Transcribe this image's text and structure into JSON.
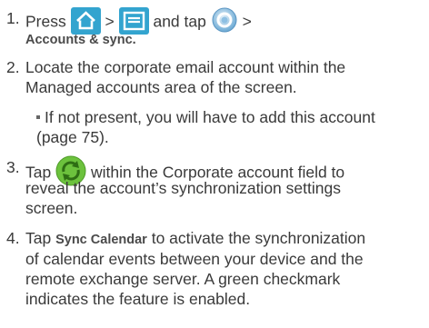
{
  "steps": [
    {
      "number": "1.",
      "line1_a": "Press",
      "sep1": ">",
      "line1_b": "and tap",
      "sep2": ">",
      "path_label": "Accounts & sync.",
      "icons": [
        "home-icon",
        "menu-icon",
        "settings-gear-icon"
      ]
    },
    {
      "number": "2.",
      "lines": [
        "Locate the corporate email account within the",
        "Managed accounts area of the screen."
      ]
    },
    {
      "bullet_lines": [
        "If not present, you will have to add this account",
        "(page 75)."
      ]
    },
    {
      "number": "3.",
      "line1_a": "Tap",
      "line1_b": "within the Corporate account field to",
      "lines": [
        "reveal the account’s synchronization settings",
        "screen."
      ],
      "icons": [
        "sync-icon"
      ]
    },
    {
      "number": "4.",
      "line1_a": "Tap",
      "bold_label": "Sync Calendar",
      "line1_b": "to activate the synchronization",
      "lines": [
        "of calendar events between your device and the",
        "remote exchange server. A green checkmark",
        "indicates the feature is enabled."
      ]
    }
  ],
  "colors": {
    "icon_blue": "#33a4cf",
    "sync_green": "#6cc23d",
    "text": "#3a3a3a"
  }
}
